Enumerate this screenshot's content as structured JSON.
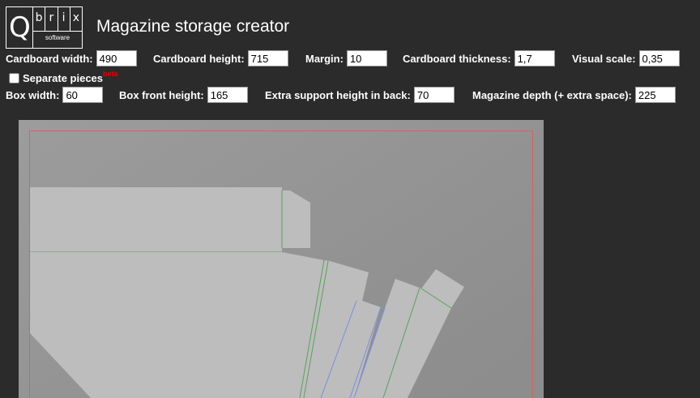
{
  "logo": {
    "q": "Q",
    "letters": [
      "b",
      "r",
      "i",
      "x"
    ],
    "sub": "software"
  },
  "title": "Magazine storage creator",
  "row1": [
    {
      "label": "Cardboard width:",
      "value": "490"
    },
    {
      "label": "Cardboard height:",
      "value": "715"
    },
    {
      "label": "Margin:",
      "value": "10"
    },
    {
      "label": "Cardboard thickness:",
      "value": "1,7"
    },
    {
      "label": "Visual scale:",
      "value": "0,35"
    }
  ],
  "separate": {
    "label": "Separate pieces",
    "badge": "beta",
    "checked": false
  },
  "row2": [
    {
      "label": "Box width:",
      "value": "60"
    },
    {
      "label": "Box front height:",
      "value": "165"
    },
    {
      "label": "Extra support height in back:",
      "value": "70"
    },
    {
      "label": "Magazine depth (+ extra space):",
      "value": "225"
    }
  ],
  "colors": {
    "background": "#2b2b2b",
    "canvas": "#9a9a9a",
    "piece": "#bdbdbd",
    "margin_line": "#d96060",
    "fold_green": "#5aa05a",
    "fold_blue": "#7a8ee0",
    "beta": "#e80000"
  }
}
